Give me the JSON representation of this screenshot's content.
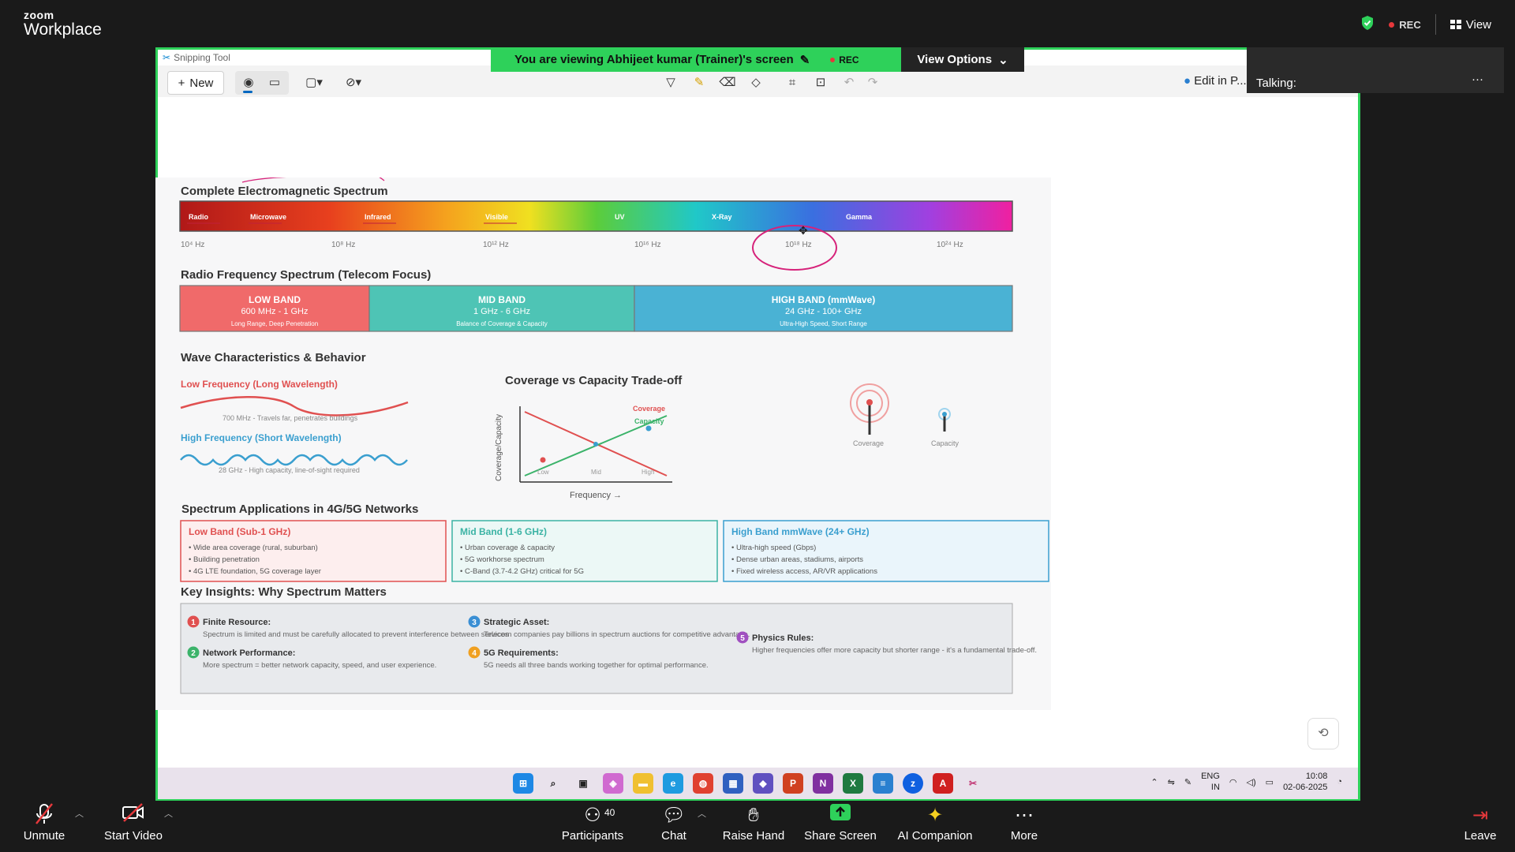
{
  "app": {
    "logo_line1": "zoom",
    "logo_line2": "Workplace"
  },
  "top_bar": {
    "rec_label": "REC",
    "view_label": "View"
  },
  "share": {
    "banner_text": "You are viewing  Abhijeet kumar (Trainer)'s screen",
    "banner_rec": "REC",
    "view_options": "View Options",
    "talking_label": "Talking:"
  },
  "snipping_tool": {
    "title": "Snipping Tool",
    "new_label": "New",
    "edit_in_label": "Edit in P..."
  },
  "slide": {
    "em_title": "Complete Electromagnetic Spectrum",
    "em_bands": [
      "Radio",
      "Microwave",
      "Infrared",
      "Visible",
      "UV",
      "X-Ray",
      "Gamma"
    ],
    "em_freqs": [
      "10⁴ Hz",
      "10⁸ Hz",
      "10¹² Hz",
      "10¹⁶ Hz",
      "10¹⁸ Hz",
      "10²⁴ Hz"
    ],
    "rf_title": "Radio Frequency Spectrum (Telecom Focus)",
    "rf_bands": [
      {
        "name": "LOW BAND",
        "range": "600 MHz - 1 GHz",
        "desc": "Long Range, Deep Penetration",
        "color": "#f06a6a"
      },
      {
        "name": "MID BAND",
        "range": "1 GHz - 6 GHz",
        "desc": "Balance of Coverage & Capacity",
        "color": "#4ec4b5"
      },
      {
        "name": "HIGH BAND (mmWave)",
        "range": "24 GHz - 100+ GHz",
        "desc": "Ultra-High Speed, Short Range",
        "color": "#4ab2d4"
      }
    ],
    "wave_title": "Wave Characteristics & Behavior",
    "low_freq_label": "Low Frequency (Long Wavelength)",
    "low_freq_note": "700 MHz - Travels far, penetrates buildings",
    "high_freq_label": "High Frequency (Short Wavelength)",
    "high_freq_note": "28 GHz - High capacity, line-of-sight required",
    "tradeoff_title": "Coverage vs Capacity Trade-off",
    "tradeoff_ylabel": "Coverage/Capacity",
    "tradeoff_xlabel": "Frequency →",
    "tradeoff_series": [
      "Coverage",
      "Capacity"
    ],
    "tradeoff_ticks": [
      "Low",
      "Mid",
      "High"
    ],
    "tower_labels": [
      "Coverage",
      "Capacity"
    ],
    "apps_title": "Spectrum Applications in 4G/5G Networks",
    "apps": [
      {
        "title": "Low Band (Sub-1 GHz)",
        "items": [
          "• Wide area coverage (rural, suburban)",
          "• Building penetration",
          "• 4G LTE foundation, 5G coverage layer"
        ],
        "color": "#e05050",
        "bg": "#fdeeee"
      },
      {
        "title": "Mid Band (1-6 GHz)",
        "items": [
          "• Urban coverage & capacity",
          "• 5G workhorse spectrum",
          "• C-Band (3.7-4.2 GHz) critical for 5G"
        ],
        "color": "#3bb3a4",
        "bg": "#ecf8f6"
      },
      {
        "title": "High Band mmWave (24+ GHz)",
        "items": [
          "• Ultra-high speed (Gbps)",
          "• Dense urban areas, stadiums, airports",
          "• Fixed wireless access, AR/VR applications"
        ],
        "color": "#3a9fcf",
        "bg": "#eaf5fb"
      }
    ],
    "insights_title": "Key Insights: Why Spectrum Matters",
    "insights": [
      {
        "num": "1",
        "title": "Finite Resource:",
        "text": "Spectrum is limited and must be carefully allocated to prevent interference between services",
        "color": "#e05050"
      },
      {
        "num": "2",
        "title": "Network Performance:",
        "text": "More spectrum = better network capacity, speed, and user experience.",
        "color": "#3bb36a"
      },
      {
        "num": "3",
        "title": "Strategic Asset:",
        "text": "Telecom companies pay billions in spectrum auctions for competitive advantage.",
        "color": "#3a8fd4"
      },
      {
        "num": "4",
        "title": "5G Requirements:",
        "text": "5G needs all three bands working together for optimal performance.",
        "color": "#f0a020"
      },
      {
        "num": "5",
        "title": "Physics Rules:",
        "text": "Higher frequencies offer more capacity but shorter range - it's a fundamental trade-off.",
        "color": "#a050c0"
      }
    ]
  },
  "taskbar": {
    "lang_line1": "ENG",
    "lang_line2": "IN",
    "time": "10:08",
    "date": "02-06-2025"
  },
  "bottom_bar": {
    "unmute": "Unmute",
    "start_video": "Start Video",
    "participants": "Participants",
    "participants_count": "40",
    "chat": "Chat",
    "raise_hand": "Raise Hand",
    "share_screen": "Share Screen",
    "ai_companion": "AI Companion",
    "more": "More",
    "leave": "Leave"
  }
}
